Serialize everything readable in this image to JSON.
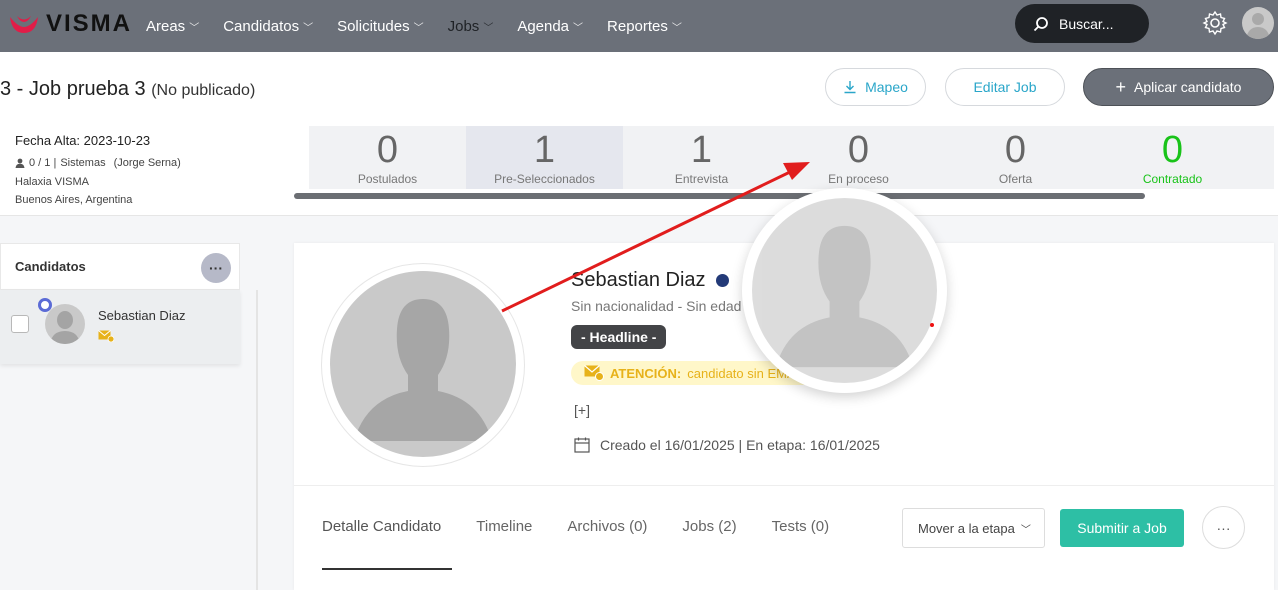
{
  "brand": {
    "name": "VISMA",
    "color": "#e11d48"
  },
  "nav": {
    "items": [
      {
        "label": "Areas",
        "active": false
      },
      {
        "label": "Candidatos",
        "active": false
      },
      {
        "label": "Solicitudes",
        "active": false
      },
      {
        "label": "Jobs",
        "active": true
      },
      {
        "label": "Agenda",
        "active": false
      },
      {
        "label": "Reportes",
        "active": false
      }
    ],
    "search_label": "Buscar..."
  },
  "job": {
    "title": "3 - Job prueba 3",
    "status": "(No publicado)",
    "buttons": {
      "mapeo": "Mapeo",
      "editar": "Editar Job",
      "aplicar": "Aplicar candidato"
    },
    "meta": {
      "fecha": "Fecha Alta: 2023-10-23",
      "counts": "0 / 1 |",
      "area": "Sistemas",
      "owner": "(Jorge Serna)",
      "company": "Halaxia VISMA",
      "location": "Buenos Aires, Argentina"
    }
  },
  "stages": [
    {
      "count": "0",
      "label": "Postulados"
    },
    {
      "count": "1",
      "label": "Pre-Seleccionados"
    },
    {
      "count": "1",
      "label": "Entrevista"
    },
    {
      "count": "0",
      "label": "En proceso"
    },
    {
      "count": "0",
      "label": "Oferta"
    },
    {
      "count": "0",
      "label": "Contratado"
    }
  ],
  "candidates_panel": {
    "title": "Candidatos",
    "more": "···",
    "items": [
      {
        "name": "Sebastian Diaz"
      }
    ]
  },
  "profile": {
    "name": "Sebastian Diaz",
    "info": "Sin nacionalidad - Sin edad - Sin género - Sin estado civil",
    "headline": "- Headline -",
    "attention_label": "ATENCIÓN:",
    "attention_text": "candidato sin EMAIL",
    "plus": "[+]",
    "created": "Creado el 16/01/2025 | En etapa: 16/01/2025",
    "tabs": [
      "Detalle Candidato",
      "Timeline",
      "Archivos (0)",
      "Jobs (2)",
      "Tests (0)"
    ],
    "move_label": "Mover a la etapa",
    "submit_label": "Submitir a Job",
    "more_label": "···"
  },
  "colors": {
    "nav_bg": "#6b7079",
    "accent": "#2aa6c9",
    "success": "#19c319",
    "submit": "#2dbfa5",
    "annotation": "#e11d1d"
  }
}
